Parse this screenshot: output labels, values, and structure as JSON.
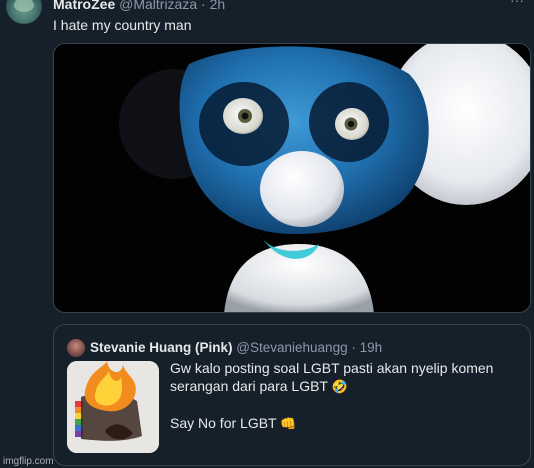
{
  "tweet": {
    "author_name": "MatroZee",
    "author_handle": "@Maltrizaza",
    "separator": "·",
    "time": "2h",
    "text": "I hate my country man",
    "more_icon": "more-dots-icon"
  },
  "quote": {
    "author_name": "Stevanie Huang (Pink)",
    "author_handle": "@Stevaniehuangg",
    "separator": "·",
    "time": "19h",
    "line1": "Gw kalo posting soal LGBT pasti akan nyelip komen",
    "line2": "serangan dari para LGBT",
    "line2_emoji": "🤣",
    "line3": "Say No for LGBT",
    "line3_emoji": "👊"
  },
  "watermark": "imgflip.com",
  "colors": {
    "background": "#15202b",
    "border": "#38444d",
    "secondary_text": "#8b98a5",
    "primary_text": "#e7e9ea"
  }
}
